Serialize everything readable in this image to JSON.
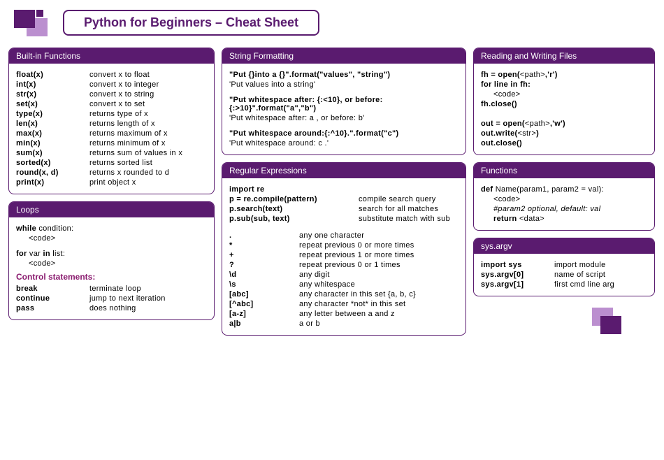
{
  "title": "Python for Beginners – Cheat Sheet",
  "panels": {
    "builtins": {
      "head": "Built-in Functions",
      "rows": [
        {
          "k": "float(x)",
          "v": "convert x to float"
        },
        {
          "k": "int(x)",
          "v": "convert x to integer"
        },
        {
          "k": "str(x)",
          "v": "convert x to string"
        },
        {
          "k": "set(x)",
          "v": "convert x to set"
        },
        {
          "k": "type(x)",
          "v": "returns type of x"
        },
        {
          "k": "len(x)",
          "v": "returns length of x"
        },
        {
          "k": "max(x)",
          "v": "returns maximum of x"
        },
        {
          "k": "min(x)",
          "v": "returns minimum of x"
        },
        {
          "k": "sum(x)",
          "v": "returns sum of values in x"
        },
        {
          "k": "sorted(x)",
          "v": "returns sorted list"
        },
        {
          "k": "round(x, d)",
          "v": "returns x rounded to d"
        },
        {
          "k": "print(x)",
          "v": "print object x"
        }
      ]
    },
    "loops": {
      "head": "Loops",
      "while1": "while condition:",
      "while2": "<code>",
      "for1": "for var in list:",
      "for2": "<code>",
      "ctrl_head": "Control statements:",
      "ctrl": [
        {
          "k": "break",
          "v": "terminate loop"
        },
        {
          "k": "continue",
          "v": "jump to next iteration"
        },
        {
          "k": "pass",
          "v": "does nothing"
        }
      ]
    },
    "strfmt": {
      "head": "String Formatting",
      "b1a": "\"Put {}into a {}\".format(\"values\", \"string\")",
      "b1b": "'Put values into a string'",
      "b2a": "\"Put whitespace after: {:<10}, or before:{:>10}\".format(\"a\",\"b\")",
      "b2b": "'Put whitespace after: a          , or before:          b'",
      "b3a": "\"Put whitespace around:{:^10}.\".format(\"c\")",
      "b3b": "'Put whitespace around:     c     .'"
    },
    "regex": {
      "head": "Regular Expressions",
      "top": [
        {
          "k": "import re",
          "v": ""
        },
        {
          "k": "p = re.compile(pattern)",
          "v": "compile search query"
        },
        {
          "k": "p.search(text)",
          "v": "search for all matches"
        },
        {
          "k": "p.sub(sub, text)",
          "v": "substitute match with sub"
        }
      ],
      "sym": [
        {
          "k": ".",
          "v": "any one character"
        },
        {
          "k": "*",
          "v": "repeat previous 0 or more times"
        },
        {
          "k": "+",
          "v": "repeat previous 1 or more times"
        },
        {
          "k": "?",
          "v": "repeat previous 0 or 1 times"
        },
        {
          "k": "\\d",
          "v": "any digit"
        },
        {
          "k": "\\s",
          "v": "any whitespace"
        },
        {
          "k": "[abc]",
          "v": "any character in this set {a, b, c}"
        },
        {
          "k": "[^abc]",
          "v": "any character *not* in this set"
        },
        {
          "k": "[a-z]",
          "v": "any letter between a and z"
        },
        {
          "k": "a|b",
          "v": "a or b"
        }
      ]
    },
    "files": {
      "head": "Reading and Writing Files",
      "lines_html": [
        "<span class='bold'>fh = open(</span>&lt;path&gt;<span class='bold'>,'r')</span>",
        "<span class='bold'>for line in fh:</span>",
        "<span class='indent'>&lt;code&gt;</span>",
        "<span class='bold'>fh.close()</span>",
        "&nbsp;",
        "<span class='bold'>out = open(</span>&lt;path&gt;<span class='bold'>,'w')</span>",
        "<span class='bold'>out.write(</span>&lt;str&gt;<span class='bold'>)</span>",
        "<span class='bold'>out.close()</span>"
      ]
    },
    "funcs": {
      "head": "Functions",
      "lines_html": [
        "<span class='bold'>def</span> Name(param1, param2 = val):",
        "<span class='indent'>&lt;code&gt;</span>",
        "<span class='indent ital'>#param2 optional, default: val</span>",
        "<span class='indent'><span class='bold'>return</span> &lt;data&gt;</span>"
      ]
    },
    "argv": {
      "head": "sys.argv",
      "rows": [
        {
          "k": "import sys",
          "v": "import module"
        },
        {
          "k": "sys.argv[0]",
          "v": "name of script"
        },
        {
          "k": "sys.argv[1]",
          "v": "first cmd line arg"
        }
      ]
    }
  }
}
